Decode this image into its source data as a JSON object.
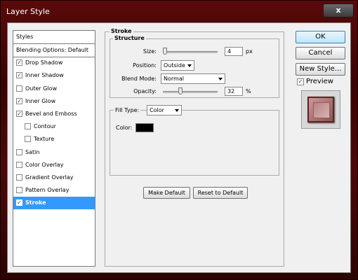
{
  "window": {
    "title": "Layer Style",
    "close_symbol": "x"
  },
  "sidebar": {
    "header": "Styles",
    "items": [
      {
        "label": "Blending Options: Default",
        "checkbox": false,
        "checked": false,
        "indent": false,
        "selected": false
      },
      {
        "label": "Drop Shadow",
        "checkbox": true,
        "checked": true,
        "indent": false,
        "selected": false
      },
      {
        "label": "Inner Shadow",
        "checkbox": true,
        "checked": true,
        "indent": false,
        "selected": false
      },
      {
        "label": "Outer Glow",
        "checkbox": true,
        "checked": false,
        "indent": false,
        "selected": false
      },
      {
        "label": "Inner Glow",
        "checkbox": true,
        "checked": true,
        "indent": false,
        "selected": false
      },
      {
        "label": "Bevel and Emboss",
        "checkbox": true,
        "checked": true,
        "indent": false,
        "selected": false
      },
      {
        "label": "Contour",
        "checkbox": true,
        "checked": false,
        "indent": true,
        "selected": false
      },
      {
        "label": "Texture",
        "checkbox": true,
        "checked": false,
        "indent": true,
        "selected": false
      },
      {
        "label": "Satin",
        "checkbox": true,
        "checked": false,
        "indent": false,
        "selected": false
      },
      {
        "label": "Color Overlay",
        "checkbox": true,
        "checked": false,
        "indent": false,
        "selected": false
      },
      {
        "label": "Gradient Overlay",
        "checkbox": true,
        "checked": false,
        "indent": false,
        "selected": false
      },
      {
        "label": "Pattern Overlay",
        "checkbox": true,
        "checked": false,
        "indent": false,
        "selected": false
      },
      {
        "label": "Stroke",
        "checkbox": true,
        "checked": true,
        "indent": false,
        "selected": true
      }
    ]
  },
  "stroke": {
    "section_title": "Stroke",
    "structure_title": "Structure",
    "size_label": "Size:",
    "size_value": "4",
    "size_unit": "px",
    "position_label": "Position:",
    "position_value": "Outside",
    "blend_mode_label": "Blend Mode:",
    "blend_mode_value": "Normal",
    "opacity_label": "Opacity:",
    "opacity_value": "32",
    "opacity_unit": "%",
    "fill_type_label": "Fill Type:",
    "fill_type_value": "Color",
    "color_label": "Color:",
    "color_value": "#000000",
    "make_default_label": "Make Default",
    "reset_default_label": "Reset to Default"
  },
  "buttons": {
    "ok": "OK",
    "cancel": "Cancel",
    "new_style": "New Style..."
  },
  "preview": {
    "label": "Preview",
    "checked": true
  },
  "colors": {
    "selection": "#3399ff",
    "title_bar": "#4a0606"
  }
}
